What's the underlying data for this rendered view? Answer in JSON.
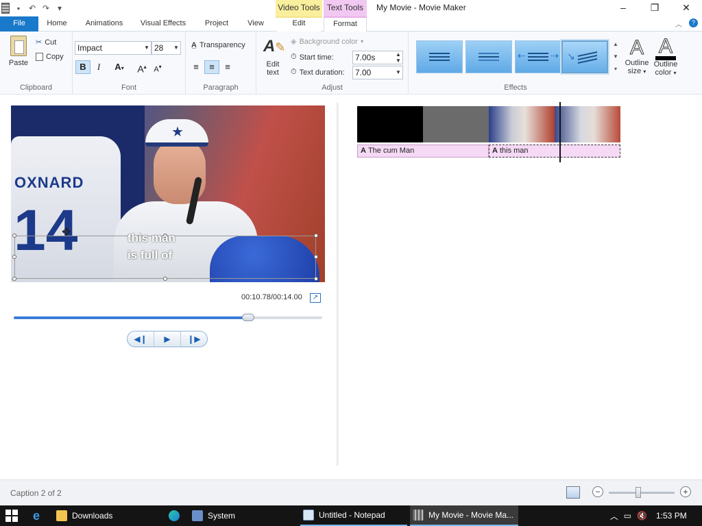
{
  "window": {
    "title": "My Movie - Movie Maker",
    "context_video_tools": "Video Tools",
    "context_text_tools": "Text Tools"
  },
  "tabs": {
    "file": "File",
    "home": "Home",
    "animations": "Animations",
    "visual_effects": "Visual Effects",
    "project": "Project",
    "view": "View",
    "edit": "Edit",
    "format": "Format"
  },
  "ribbon": {
    "clipboard": {
      "label": "Clipboard",
      "paste": "Paste",
      "cut": "Cut",
      "copy": "Copy"
    },
    "font": {
      "label": "Font",
      "family": "Impact",
      "size": "28",
      "bold": "B",
      "italic": "I",
      "color": "A",
      "grow": "A",
      "shrink": "A"
    },
    "transparency": "Transparency",
    "paragraph": {
      "label": "Paragraph"
    },
    "adjust": {
      "label": "Adjust",
      "edit_text_line1": "Edit",
      "edit_text_line2": "text",
      "background_color": "Background color",
      "start_time_label": "Start time:",
      "start_time_value": "7.00s",
      "duration_label": "Text duration:",
      "duration_value": "7.00"
    },
    "effects": {
      "label": "Effects",
      "selected_index": 3
    },
    "outline_size": {
      "line1": "Outline",
      "line2": "size"
    },
    "outline_color": {
      "line1": "Outline",
      "line2": "color"
    }
  },
  "preview": {
    "caption_line1": "this man",
    "caption_line2": "is full of",
    "jersey_name": "OXNARD",
    "jersey_number": "14",
    "timecode": "00:10.78/00:14.00",
    "progress": 0.76
  },
  "storyboard": {
    "captions": [
      {
        "text": "The cum Man"
      },
      {
        "text": "this man"
      }
    ]
  },
  "status": {
    "caption_counter": "Caption 2 of 2",
    "zoom": 0.45
  },
  "taskbar": {
    "items": [
      {
        "label": "Downloads"
      },
      {
        "label": "System"
      },
      {
        "label": "Untitled - Notepad"
      },
      {
        "label": "My Movie - Movie Ma..."
      }
    ],
    "clock": "1:53 PM"
  },
  "colors": {
    "file_tab": "#1979ca",
    "video_tools": "#f9ef9c",
    "text_tools": "#f1c8f1",
    "caption_strip": "#f5d9f5",
    "seek_fill": "#3b7dd8"
  }
}
